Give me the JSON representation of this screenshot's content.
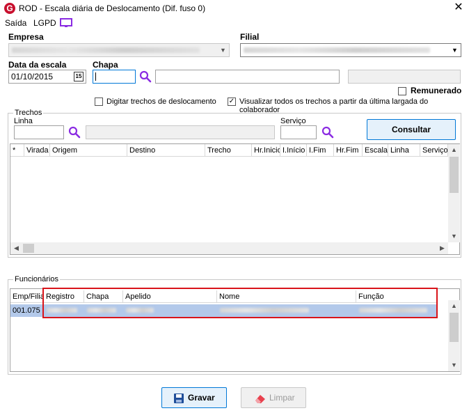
{
  "window": {
    "title": "ROD - Escala diária de Deslocamento (Dif. fuso 0)",
    "app_icon_letter": "G",
    "close_glyph": "✕"
  },
  "menu": {
    "items": [
      "Saída",
      "LGPD"
    ]
  },
  "labels": {
    "empresa": "Empresa",
    "filial": "Filial",
    "data_escala": "Data da escala",
    "chapa": "Chapa",
    "remunerado": "Remunerado",
    "digitar_trechos": "Digitar trechos de deslocamento",
    "visualizar_todos": "Visualizar todos os trechos a partir da última largada do colaborador",
    "trechos_group": "Trechos",
    "linha": "Linha",
    "servico": "Serviço",
    "funcionarios_group": "Funcionários"
  },
  "fields": {
    "data_escala_value": "01/10/2015",
    "calendar_day": "15"
  },
  "checkboxes": {
    "remunerado": false,
    "digitar_trechos": false,
    "visualizar_todos": true
  },
  "buttons": {
    "consultar": "Consultar",
    "gravar": "Gravar",
    "limpar": "Limpar"
  },
  "trechos_grid": {
    "columns": [
      "*",
      "Virada",
      "Origem",
      "Destino",
      "Trecho",
      "Hr.Inicio",
      "I.Início",
      "I.Fim",
      "Hr.Fim",
      "Escala",
      "Linha",
      "Serviço"
    ]
  },
  "funcionarios_grid": {
    "columns": [
      "Emp/Filial",
      "Registro",
      "Chapa",
      "Apelido",
      "Nome",
      "Função"
    ],
    "rows": [
      {
        "emp_filial": "001.075"
      }
    ]
  },
  "colors": {
    "accent_icon": "#8a2be2",
    "highlight_border": "#d9141a",
    "selected_row": "#b3c9ea",
    "brand": "#c8102e"
  },
  "icons": {
    "search": "magnifier-icon",
    "monitor": "monitor-icon",
    "calendar": "calendar-icon",
    "save": "floppy-icon",
    "clear": "eraser-icon"
  }
}
